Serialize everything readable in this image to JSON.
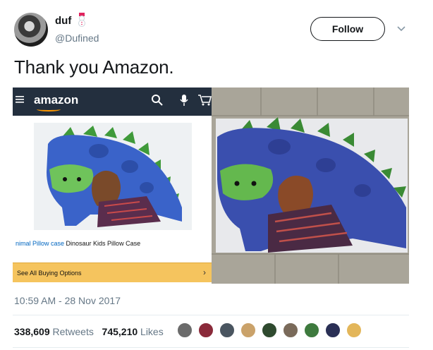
{
  "author": {
    "name": "duf",
    "handle": "@Dufined",
    "name_emoji": "snowman-emoji"
  },
  "follow_label": "Follow",
  "caret_icon": "chevron-down-icon",
  "tweet": {
    "text": "Thank you Amazon."
  },
  "media": {
    "left": {
      "brand": "amazon",
      "icons": [
        "menu-icon",
        "search-icon",
        "microphone-icon",
        "cart-icon"
      ],
      "caption_link": "nimal Pillow case",
      "caption_rest": " Dinosaur Kids Pillow Case",
      "buy_label": "See All Buying Options",
      "buy_chevron": "›"
    },
    "right": {
      "description_icon": "pillow-photo"
    }
  },
  "timestamp": "10:59 AM - 28 Nov 2017",
  "stats": {
    "retweets_count": "338,609",
    "retweets_label": "Retweets",
    "likes_count": "745,210",
    "likes_label": "Likes"
  },
  "colors": {
    "amazon_bar": "#232f3e",
    "amazon_accent": "#ff9900",
    "buy_button": "#f5c45e",
    "secondary_text": "#657786",
    "link": "#0066c0"
  },
  "liker_colors": [
    "#6b6b6b",
    "#8a2a3a",
    "#4a5560",
    "#caa26a",
    "#2f4a2f",
    "#7a6a5a",
    "#3e7a3e",
    "#2a2f55",
    "#e3b65a"
  ]
}
